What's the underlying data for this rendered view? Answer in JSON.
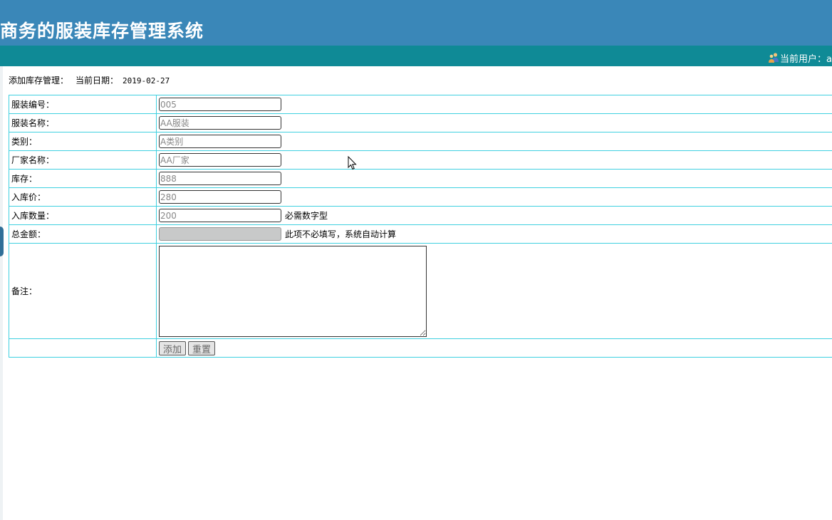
{
  "header": {
    "title": "商务的服装库存管理系统",
    "current_user_label": "当前用户：a"
  },
  "breadcrumb": {
    "action": "添加库存管理：",
    "date_label": "当前日期：",
    "date_value": "2019-02-27"
  },
  "form": {
    "fields": [
      {
        "label": "服装编号：",
        "value": "005"
      },
      {
        "label": "服装名称：",
        "value": "AA服装"
      },
      {
        "label": "类别：",
        "value": "A类别"
      },
      {
        "label": "厂家名称：",
        "value": "AA厂家"
      },
      {
        "label": "库存：",
        "value": "888"
      },
      {
        "label": "入库价：",
        "value": "280"
      },
      {
        "label": "入库数量：",
        "value": "200",
        "hint": "必需数字型"
      },
      {
        "label": "总金额：",
        "value": "",
        "hint": "此项不必填写，系统自动计算"
      }
    ],
    "remark_label": "备注：",
    "remark_value": "",
    "add_button": "添加",
    "reset_button": "重置"
  },
  "colors": {
    "header_bg": "#3a87b8",
    "userbar_bg": "#0f8a96",
    "table_border": "#3fd0e0"
  }
}
